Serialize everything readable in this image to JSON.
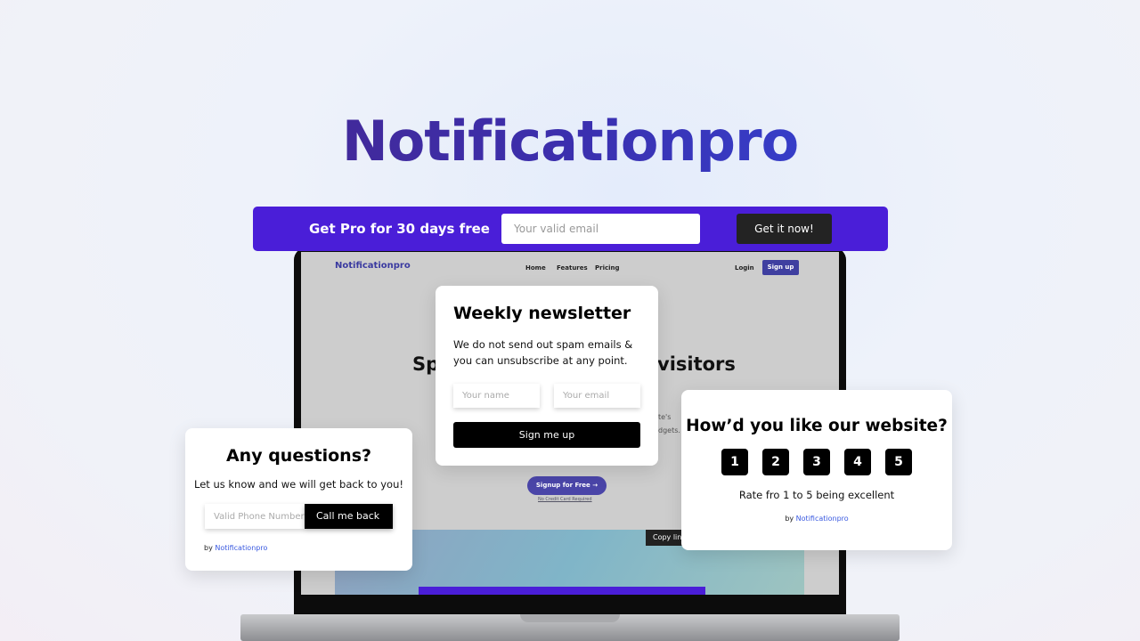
{
  "logo": "Notificationpro",
  "banner": {
    "text": "Get Pro for 30 days free",
    "email_placeholder": "Your valid email",
    "button": "Get it now!",
    "color": "#4a1ed8"
  },
  "site": {
    "logo": "Notificationpro",
    "nav": [
      "Home",
      "Features",
      "Pricing"
    ],
    "login": "Login",
    "signup": "Sign up",
    "heading_left": "Sp",
    "heading_right": "visitors",
    "frag1": "te's",
    "frag2": "dgets.",
    "cta": "Signup for Free →",
    "no_card": "No Credit Card Required",
    "copy_link": "Copy link"
  },
  "newsletter": {
    "title": "Weekly newsletter",
    "text": "We do not send out spam emails & you can unsubscribe at any point.",
    "name_placeholder": "Your name",
    "email_placeholder": "Your email",
    "button": "Sign me up"
  },
  "questions": {
    "title": "Any questions?",
    "text": "Let us know and we will get back to you!",
    "phone_placeholder": "Valid Phone Number",
    "button": "Call me back",
    "by": "by",
    "brand": "Notificationpro"
  },
  "rating": {
    "title": "How’d you like our website?",
    "options": [
      "1",
      "2",
      "3",
      "4",
      "5"
    ],
    "caption": "Rate fro 1 to 5 being excellent",
    "by": "by",
    "brand": "Notificationpro"
  }
}
